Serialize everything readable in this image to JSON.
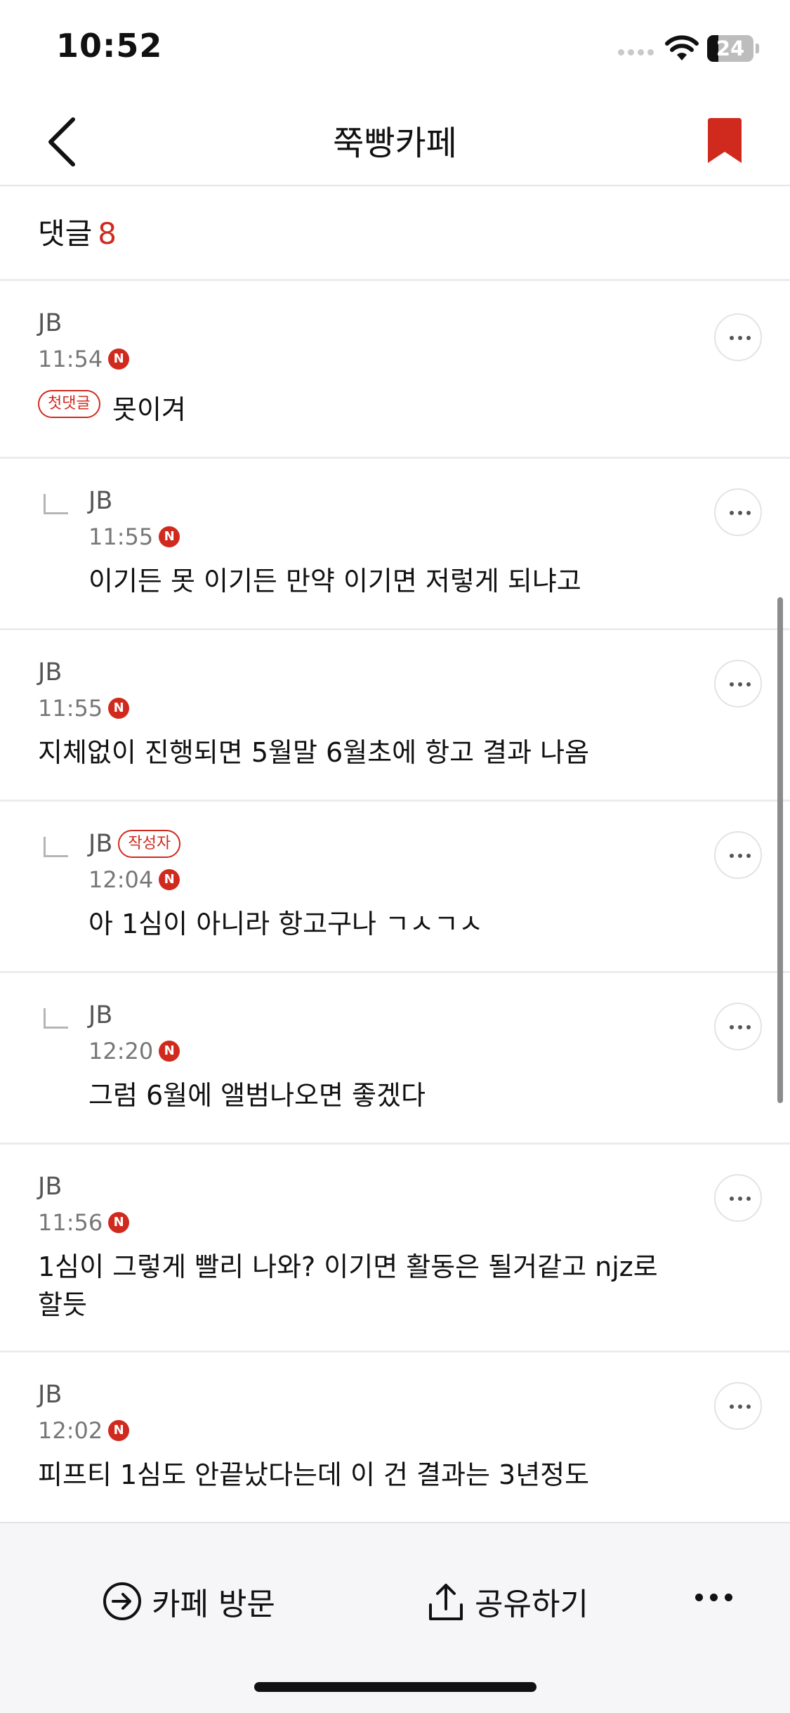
{
  "status_bar": {
    "time": "10:52",
    "battery": "24",
    "battery_level": 0.24
  },
  "header": {
    "title": "쭉빵카페"
  },
  "comments_header": {
    "label": "댓글",
    "count": "8"
  },
  "comments": [
    {
      "author": "JB",
      "time": "11:54",
      "badge": "N",
      "tag": "첫댓글",
      "text": "못이겨",
      "is_reply": false
    },
    {
      "author": "JB",
      "time": "11:55",
      "badge": "N",
      "text": "이기든 못 이기든 만약 이기면 저렇게 되냐고",
      "is_reply": true
    },
    {
      "author": "JB",
      "time": "11:55",
      "badge": "N",
      "text": "지체없이 진행되면 5월말 6월초에 항고 결과 나옴",
      "is_reply": false
    },
    {
      "author": "JB",
      "author_tag": "작성자",
      "time": "12:04",
      "badge": "N",
      "text": "아 1심이 아니라 항고구나 ㄱㅅㄱㅅ",
      "is_reply": true
    },
    {
      "author": "JB",
      "time": "12:20",
      "badge": "N",
      "text": "그럼 6월에 앨범나오면 좋겠다",
      "is_reply": true
    },
    {
      "author": "JB",
      "time": "11:56",
      "badge": "N",
      "text_line1": "1심이 그렇게 빨리 나와? 이기면 활동은 될거같고 njz로",
      "text_line2": "할듯",
      "is_reply": false
    },
    {
      "author": "JB",
      "time": "12:02",
      "badge": "N",
      "text": "피프티 1심도 안끝났다는데 이 건 결과는 3년정도",
      "is_reply": false
    }
  ],
  "bottom_bar": {
    "visit_label": "카페 방문",
    "share_label": "공유하기"
  },
  "icons": {
    "back": "chevron-left-icon",
    "bookmark": "bookmark-icon",
    "more": "ellipsis-icon",
    "reply": "reply-corner-icon",
    "visit": "arrow-circle-right-icon",
    "share": "share-upload-icon"
  },
  "colors": {
    "accent": "#d02a1e",
    "text": "#111111",
    "muted": "#777777",
    "divider": "#ececec",
    "toolbar_bg": "#f6f6f8"
  }
}
